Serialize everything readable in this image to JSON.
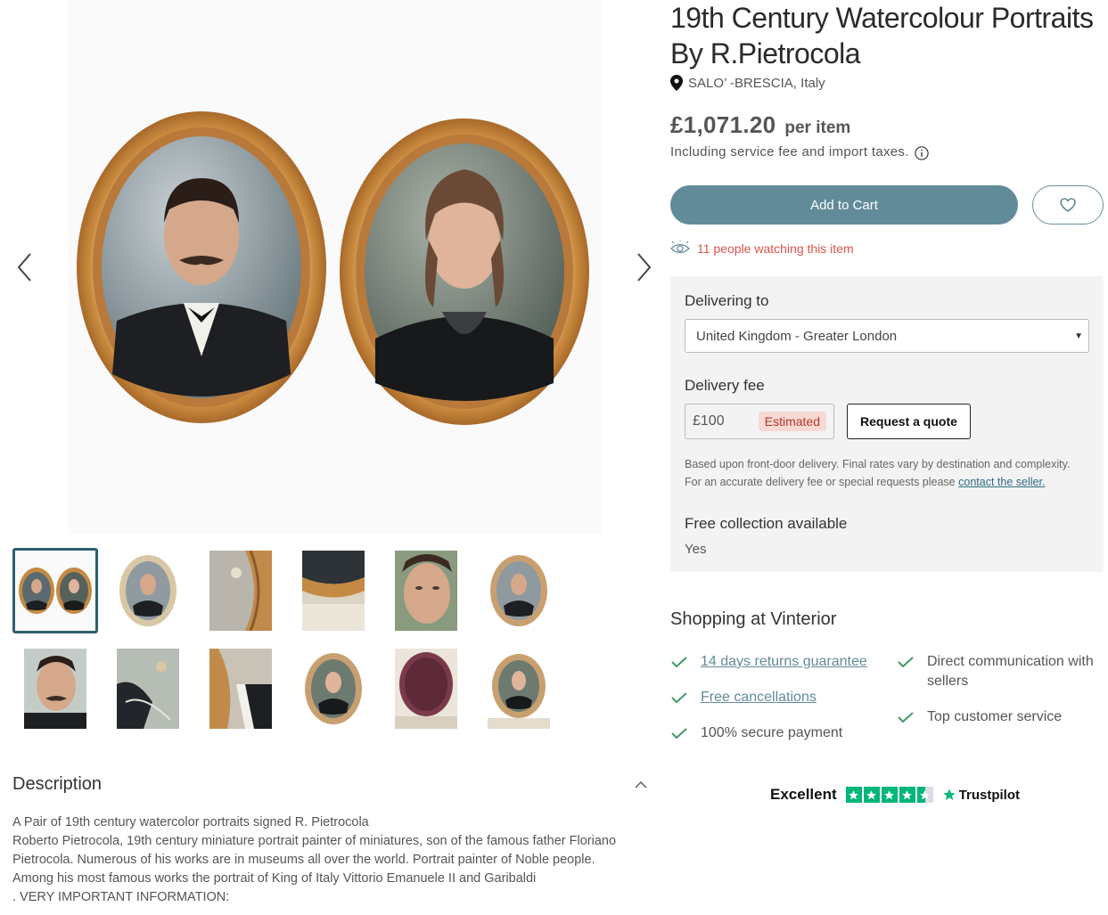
{
  "product": {
    "title": "19th Century Watercolour Portraits By R.Pietrocola",
    "location": "SALO’ -BRESCIA, Italy",
    "price": "£1,071.20",
    "per_item": "per item",
    "taxes_note": "Including service fee and import taxes.",
    "add_to_cart": "Add to Cart",
    "watching": "11 people watching this item"
  },
  "delivery": {
    "delivering_to_label": "Delivering to",
    "country_selected": "United Kingdom - Greater London",
    "fee_label": "Delivery fee",
    "fee_value": "£100",
    "estimated_badge": "Estimated",
    "request_quote": "Request a quote",
    "note": "Based upon front-door delivery. Final rates vary by destination and complexity. For an accurate delivery fee or special requests please",
    "note_link": "contact the seller.",
    "free_collection_label": "Free collection available",
    "free_collection_value": "Yes"
  },
  "shopping": {
    "title": "Shopping at Vinterior",
    "left_features": [
      {
        "text": "14 days returns guarantee",
        "link": true
      },
      {
        "text": "Free cancellations",
        "link": true
      },
      {
        "text": "100% secure payment",
        "link": false
      }
    ],
    "right_features": [
      {
        "text": "Direct communication with sellers",
        "link": false
      },
      {
        "text": "Top customer service",
        "link": false
      }
    ]
  },
  "trustpilot": {
    "rating_word": "Excellent",
    "brand": "Trustpilot",
    "stars": 4.5,
    "color": "#00b67a"
  },
  "description": {
    "title": "Description",
    "lines": [
      "A Pair of 19th century watercolor portraits signed R. Pietrocola",
      "Roberto Pietrocola, 19th century miniature portrait painter of miniatures, son of the famous father Floriano",
      "Pietrocola. Numerous of his works are in museums all over the world. Portrait painter of Noble people.",
      "Among his most famous works the portrait of King of Italy Vittorio Emanuele II and Garibaldi",
      ". VERY IMPORTANT INFORMATION:"
    ]
  },
  "gallery": {
    "thumbnail_count": 12,
    "active_index": 0
  },
  "colors": {
    "accent": "#628b9a",
    "active_border": "#2f5f6e",
    "watching": "#d9534f",
    "estimated_bg": "#f9d9d3",
    "link": "#2f6b82"
  }
}
